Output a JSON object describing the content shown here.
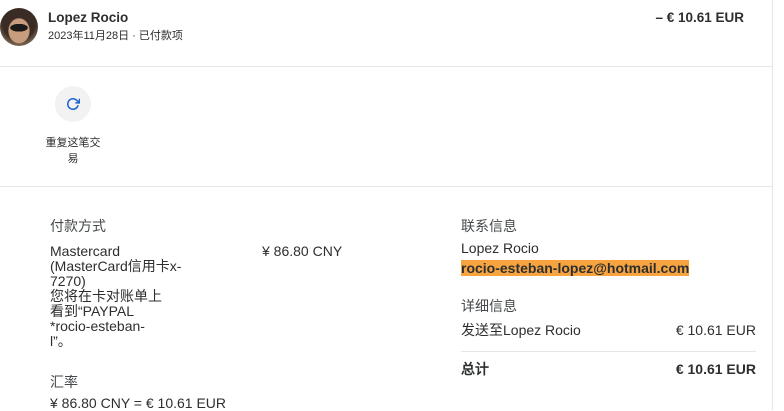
{
  "header": {
    "name": "Lopez Rocio",
    "date_status": "2023年11月28日 · 已付款项",
    "amount": "– € 10.61 EUR"
  },
  "actions": {
    "repeat_label": "重复这笔交易",
    "repeat_icon": "refresh-icon"
  },
  "payment": {
    "label": "付款方式",
    "lines": [
      "Mastercard",
      "(MasterCard信用卡x-",
      "7270)",
      "您将在卡对账单上",
      "看到“PAYPAL",
      "*rocio-esteban-",
      "l”。"
    ],
    "amount": "¥ 86.80 CNY"
  },
  "exchange": {
    "label": "汇率",
    "value": "¥ 86.80 CNY = € 10.61 EUR"
  },
  "contact": {
    "label": "联系信息",
    "name": "Lopez Rocio",
    "email": "rocio-esteban-lopez@hotmail.com"
  },
  "details": {
    "label": "详细信息",
    "sent_to": "发送至Lopez Rocio",
    "sent_amount": "€ 10.61 EUR",
    "total_label": "总计",
    "total_amount": "€ 10.61 EUR"
  },
  "colors": {
    "text": "#2c2e2f",
    "accent": "#1d63d0",
    "highlight": "#f7a440",
    "divider": "#e6e6e6",
    "button-bg": "#f2f2f2"
  }
}
